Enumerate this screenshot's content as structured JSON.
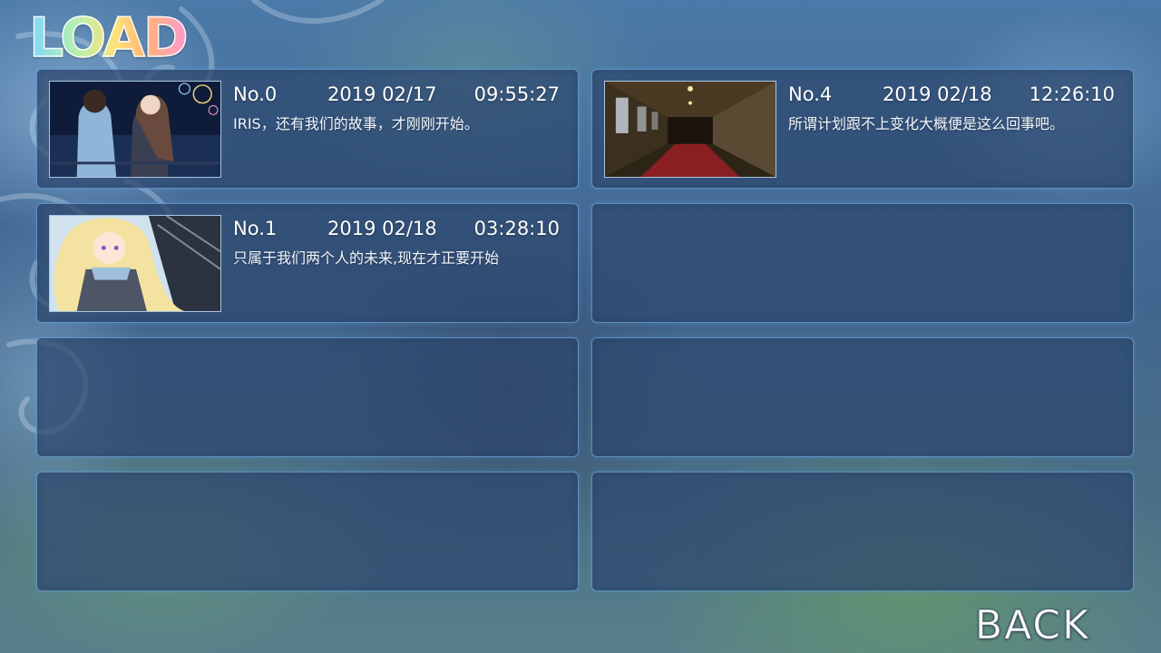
{
  "screen": {
    "title": "LOAD",
    "back_label": "BACK"
  },
  "slots": [
    {
      "no": "No.0",
      "date": "2019 02/17",
      "time": "09:55:27",
      "text": "IRIS，还有我们的故事，才刚刚开始。",
      "thumb": "couple-fireworks"
    },
    {
      "no": "No.4",
      "date": "2019 02/18",
      "time": "12:26:10",
      "text": "所谓计划跟不上变化大概便是这么回事吧。",
      "thumb": "hallway"
    },
    {
      "no": "No.1",
      "date": "2019 02/18",
      "time": "03:28:10",
      "text": "只属于我们两个人的未来,现在才正要开始",
      "thumb": "blonde-girl"
    },
    {
      "empty": true
    },
    {
      "empty": true
    },
    {
      "empty": true
    },
    {
      "empty": true
    },
    {
      "empty": true
    }
  ],
  "colors": {
    "panel": "#2c466e",
    "panel_border": "#78afe6",
    "text": "#ffffff"
  }
}
